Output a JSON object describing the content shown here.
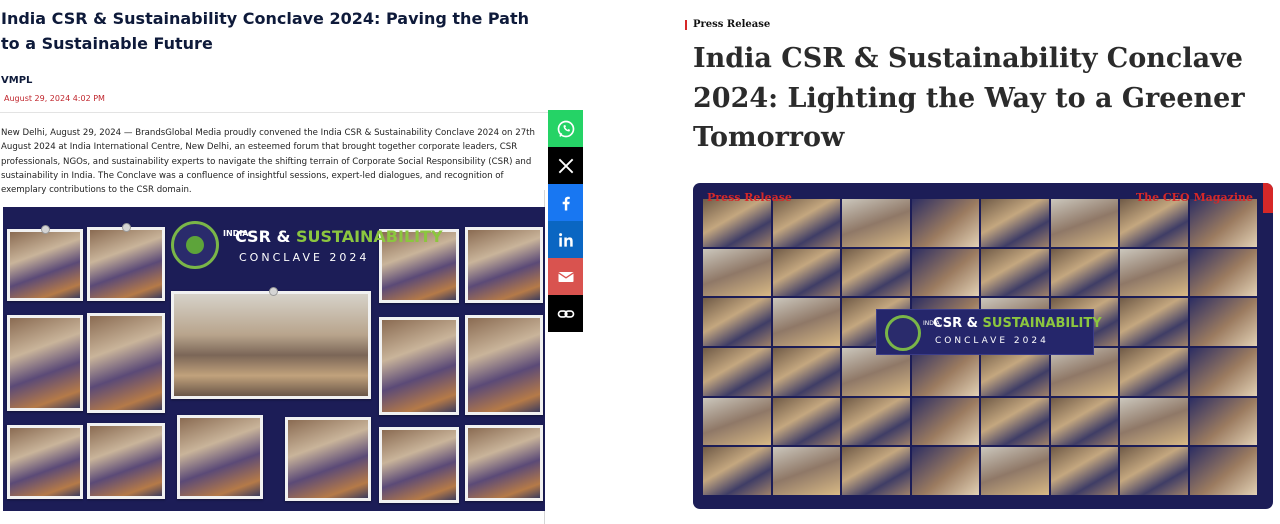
{
  "left_article": {
    "title": "India CSR & Sustainability Conclave 2024: Paving the Path to a Sustainable Future",
    "author": "VMPL",
    "date": "August 29, 2024 4:02 PM",
    "body": "New Delhi, August 29, 2024 — BrandsGlobal Media proudly convened the India CSR & Sustainability Conclave 2024 on 27th August 2024 at India International Centre, New Delhi, an esteemed forum that brought together corporate leaders, CSR professionals, NGOs, and sustainability experts to navigate the shifting terrain of Corporate Social Responsibility (CSR) and sustainability in India. The Conclave was a confluence of insightful sessions, expert-led dialogues, and recognition of exemplary contributions to the CSR domain.",
    "collage_logo": {
      "india": "INDIA",
      "csr": "CSR",
      "amp": " & ",
      "sustainability": "SUSTAINABILITY",
      "conclave": "CONCLAVE 2024"
    }
  },
  "share": {
    "items": [
      {
        "name": "whatsapp",
        "color": "#25d366",
        "icon": "whatsapp-icon"
      },
      {
        "name": "x",
        "color": "#000000",
        "icon": "x-icon"
      },
      {
        "name": "facebook",
        "color": "#1877f2",
        "icon": "facebook-icon"
      },
      {
        "name": "linkedin",
        "color": "#0a66c2",
        "icon": "linkedin-icon"
      },
      {
        "name": "email",
        "color": "#d9534f",
        "icon": "email-icon"
      },
      {
        "name": "copy-link",
        "color": "#000000",
        "icon": "link-icon"
      }
    ]
  },
  "right_article": {
    "kicker": "Press Release",
    "title": "India CSR & Sustainability Conclave 2024: Lighting the Way to a Greener Tomorrow",
    "hero_tag_left": "Press Release",
    "hero_tag_right": "The CEO Magazine",
    "hero_logo": {
      "india": "INDIA",
      "csr": "CSR",
      "amp": " & ",
      "sustainability": "SUSTAINABILITY",
      "conclave": "CONCLAVE 2024"
    }
  },
  "colors": {
    "navy": "#1c1d57",
    "accent_red": "#d62828",
    "logo_green": "#8cc63f"
  }
}
